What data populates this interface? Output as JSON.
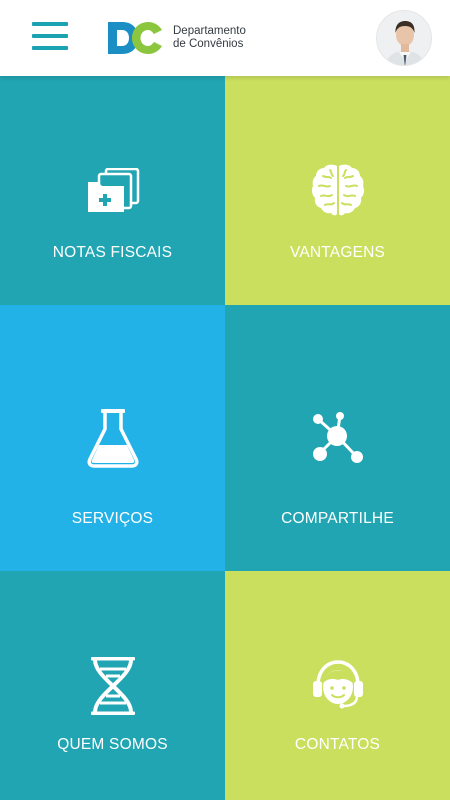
{
  "header": {
    "menu_icon": "hamburger-menu-icon",
    "logo_mark": "DC",
    "logo_line1": "Departamento",
    "logo_line2": "de Convênios",
    "avatar_icon": "user-avatar-photo"
  },
  "colors": {
    "teal": "#22a5b2",
    "lime": "#cbdf5e",
    "sky": "#22b2e8",
    "logo_blue": "#1b8fc4",
    "logo_green": "#8cc63f",
    "menu": "#1ba3b1"
  },
  "tiles": [
    {
      "label": "NOTAS FISCAIS",
      "icon": "medical-folders-icon",
      "color": "#22a5b2"
    },
    {
      "label": "VANTAGENS",
      "icon": "brain-icon",
      "color": "#cbdf5e"
    },
    {
      "label": "SERVIÇOS",
      "icon": "lab-flask-icon",
      "color": "#22b2e8"
    },
    {
      "label": "COMPARTILHE",
      "icon": "molecule-share-icon",
      "color": "#22a5b2"
    },
    {
      "label": "QUEM SOMOS",
      "icon": "dna-icon",
      "color": "#22a5b2"
    },
    {
      "label": "CONTATOS",
      "icon": "headset-support-icon",
      "color": "#cbdf5e"
    }
  ]
}
